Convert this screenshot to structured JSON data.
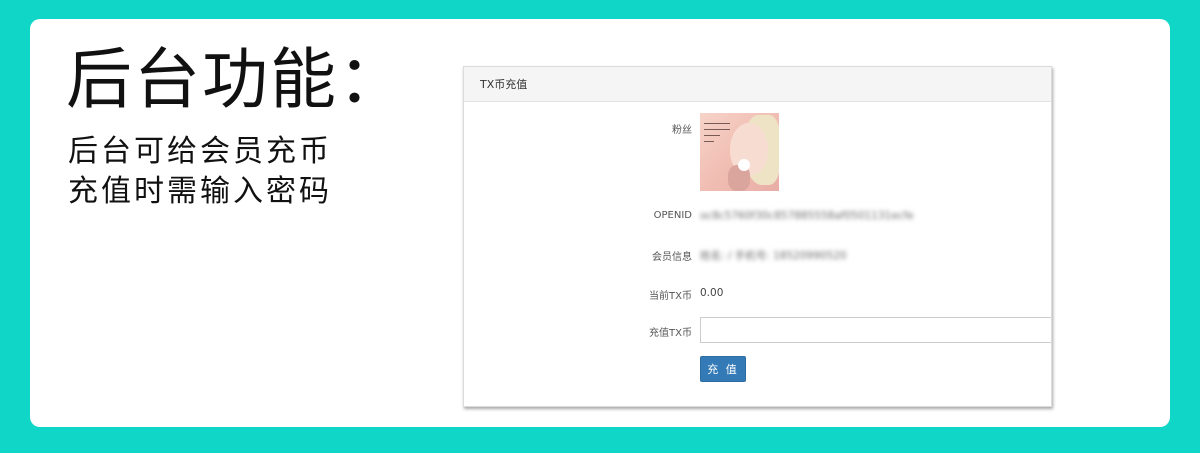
{
  "promo": {
    "headline": "后台功能：",
    "desc_lines": [
      "后台可给会员充币",
      "充值时需输入密码"
    ]
  },
  "panel": {
    "title": "TX币充值",
    "fields": {
      "fan": {
        "label": "粉丝"
      },
      "openid": {
        "label": "OPENID",
        "value": "oc8c5760f30c857885558af0501131ecfe"
      },
      "member": {
        "label": "会员信息",
        "value": "姓名: / 手机号: 18520990520"
      },
      "current": {
        "label": "当前TX币",
        "value": "0.00"
      },
      "recharge": {
        "label": "充值TX币",
        "value": "",
        "placeholder": ""
      }
    },
    "submit_label": "充 值"
  },
  "colors": {
    "page_bg": "#10d6c8",
    "primary_button": "#337ab7"
  }
}
